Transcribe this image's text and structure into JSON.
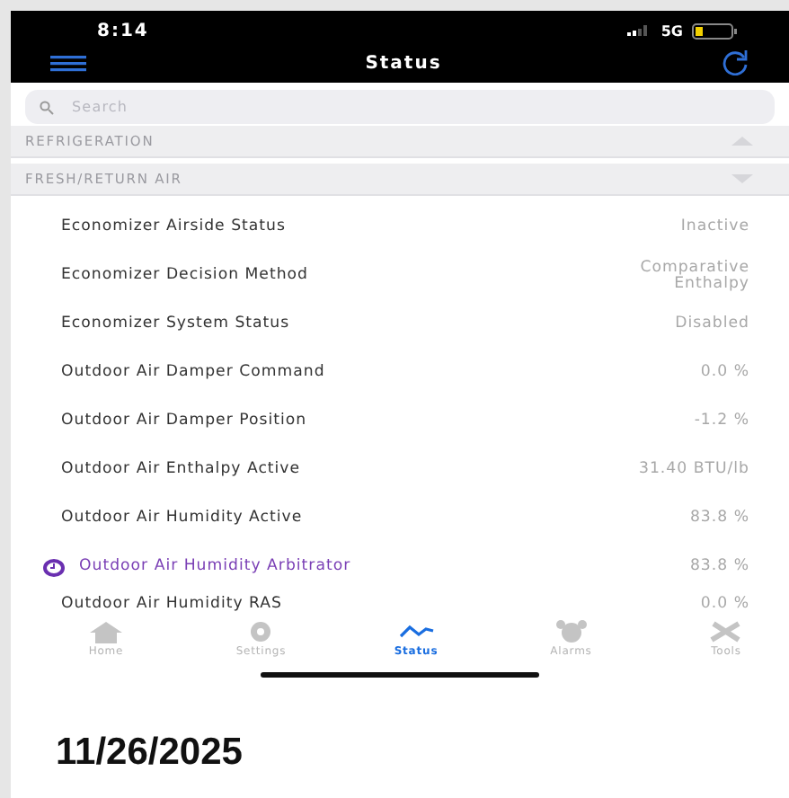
{
  "status_bar": {
    "time": "8:14",
    "network": "5G"
  },
  "nav": {
    "title": "Status"
  },
  "search": {
    "placeholder": "Search"
  },
  "sections": [
    {
      "title": "REFRIGERATION",
      "expanded": false
    },
    {
      "title": "FRESH/RETURN AIR",
      "expanded": true
    }
  ],
  "rows": [
    {
      "kind": "plain",
      "label": "Economizer Airside Status",
      "value": "Inactive"
    },
    {
      "kind": "plain",
      "label": "Economizer Decision Method",
      "value": "Comparative Enthalpy"
    },
    {
      "kind": "plain",
      "label": "Economizer System Status",
      "value": "Disabled"
    },
    {
      "kind": "plain",
      "label": "Outdoor Air Damper Command",
      "value": "0.0 %"
    },
    {
      "kind": "plain",
      "label": "Outdoor Air Damper Position",
      "value": "-1.2 %"
    },
    {
      "kind": "plain",
      "label": "Outdoor Air Enthalpy Active",
      "value": "31.40 BTU/lb"
    },
    {
      "kind": "plain",
      "label": "Outdoor Air Humidity Active",
      "value": "83.8 %"
    },
    {
      "kind": "timed",
      "label": "Outdoor Air Humidity Arbitrator",
      "value": "83.8 %"
    },
    {
      "kind": "plain",
      "label": "Outdoor Air Humidity RAS",
      "value": "0.0 %"
    }
  ],
  "tabs": [
    {
      "label": "Home",
      "selected": false
    },
    {
      "label": "Settings",
      "selected": false
    },
    {
      "label": "Status",
      "selected": true
    },
    {
      "label": "Alarms",
      "selected": false
    },
    {
      "label": "Tools",
      "selected": false
    }
  ],
  "date": "11/26/2025"
}
